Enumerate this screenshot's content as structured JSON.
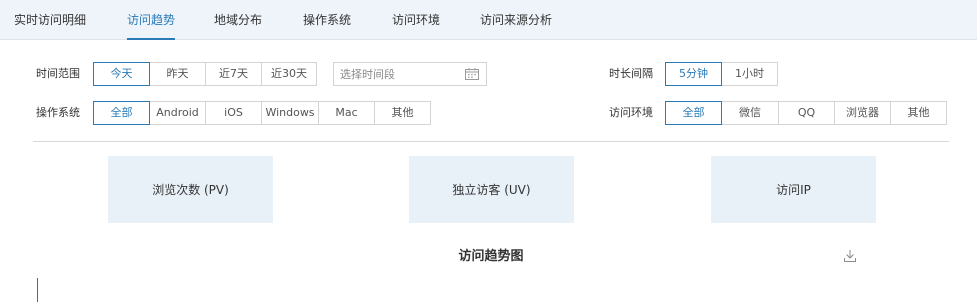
{
  "tabs": [
    {
      "label": "实时访问明细",
      "active": false
    },
    {
      "label": "访问趋势",
      "active": true
    },
    {
      "label": "地域分布",
      "active": false
    },
    {
      "label": "操作系统",
      "active": false
    },
    {
      "label": "访问环境",
      "active": false
    },
    {
      "label": "访问来源分析",
      "active": false
    }
  ],
  "filters": {
    "time_range": {
      "label": "时间范围",
      "options": [
        "今天",
        "昨天",
        "近7天",
        "近30天"
      ],
      "selected": "今天",
      "date_placeholder": "选择时间段"
    },
    "interval": {
      "label": "时长间隔",
      "options": [
        "5分钟",
        "1小时"
      ],
      "selected": "5分钟"
    },
    "os": {
      "label": "操作系统",
      "options": [
        "全部",
        "Android",
        "iOS",
        "Windows",
        "Mac",
        "其他"
      ],
      "selected": "全部"
    },
    "env": {
      "label": "访问环境",
      "options": [
        "全部",
        "微信",
        "QQ",
        "浏览器",
        "其他"
      ],
      "selected": "全部"
    }
  },
  "stats": [
    "浏览次数 (PV)",
    "独立访客 (UV)",
    "访问IP"
  ],
  "chart": {
    "title": "访问趋势图"
  },
  "colors": {
    "accent": "#2a7ab8",
    "tab_bar_bg": "#eef4fa",
    "card_bg": "#e9f1f8"
  },
  "icons": [
    "calendar-icon",
    "download-icon"
  ]
}
